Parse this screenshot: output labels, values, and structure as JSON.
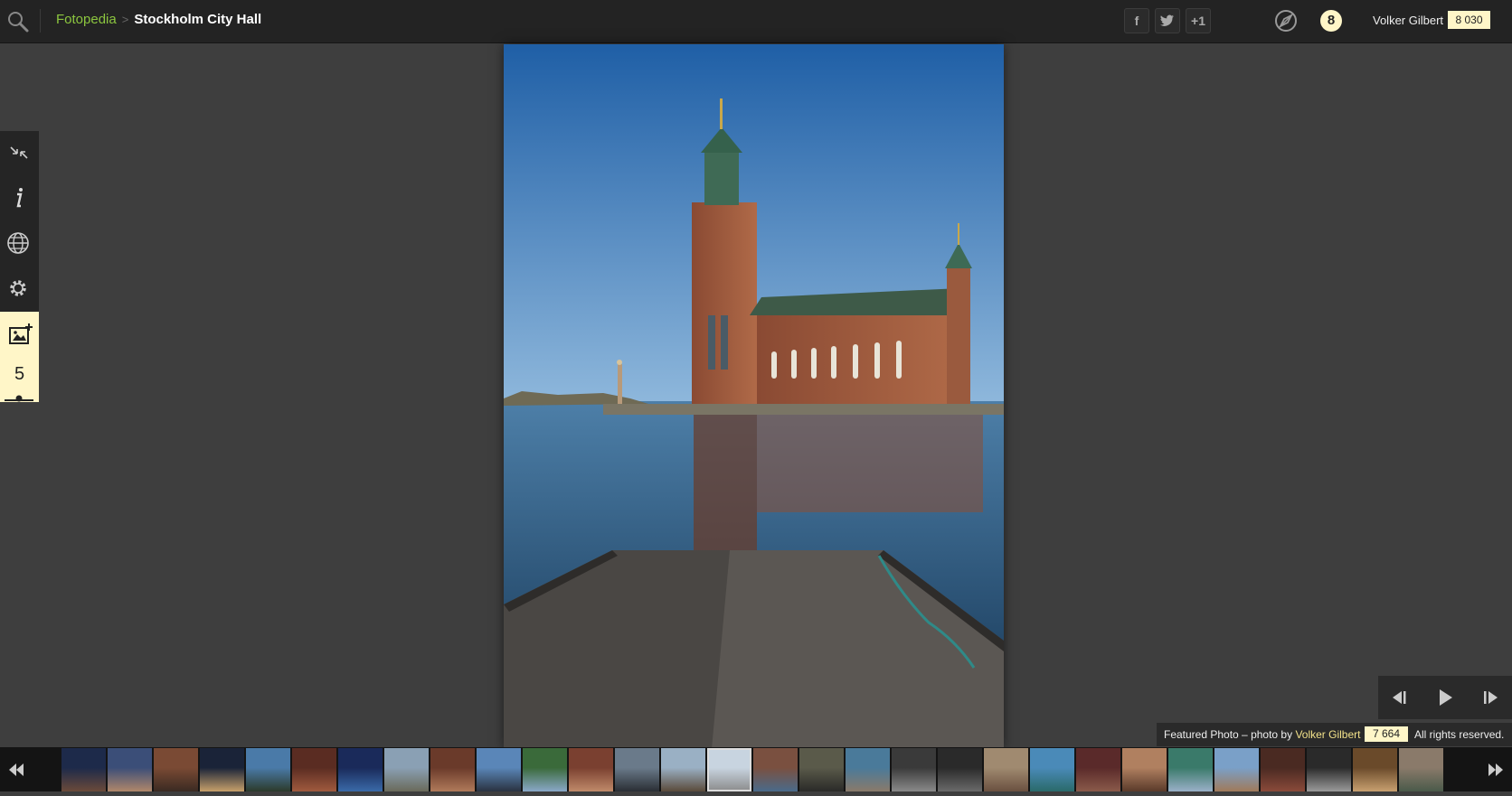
{
  "header": {
    "site_name": "Fotopedia",
    "separator": ">",
    "page_title": "Stockholm City Hall",
    "share": [
      {
        "label": "f",
        "icon": "facebook-icon"
      },
      {
        "label": "t",
        "icon": "twitter-icon"
      },
      {
        "label": "+1",
        "icon": "google-plus-icon"
      }
    ],
    "notifications_count": "8",
    "user_name": "Volker Gilbert",
    "user_score": "8 030"
  },
  "left_toolbar": {
    "items": [
      "collapse-icon",
      "info-icon",
      "globe-icon",
      "settings-icon",
      "add-photo-icon"
    ],
    "rating_count": "5"
  },
  "caption": {
    "prefix": "Featured Photo – photo by",
    "author": "Volker Gilbert",
    "score": "7 664",
    "rights": "All rights reserved."
  },
  "playback": [
    "previous-icon",
    "play-icon",
    "next-icon"
  ],
  "filmstrip": {
    "thumbnail_count": 30,
    "accent_color": "#fff6c8",
    "link_color": "#8cc63f"
  }
}
